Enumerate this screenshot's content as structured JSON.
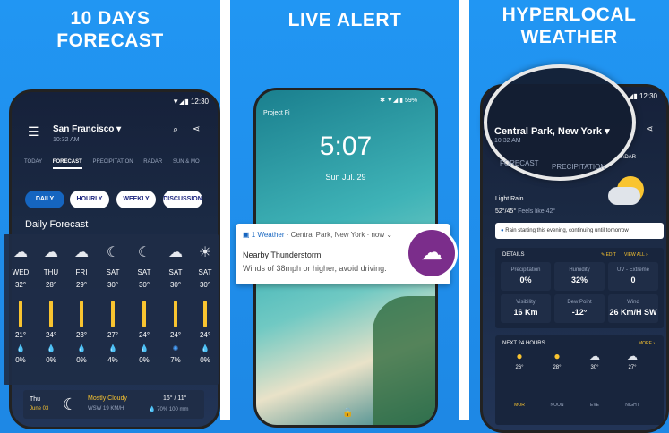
{
  "panel1": {
    "headline": [
      "10 DAYS",
      "FORECAST"
    ],
    "time": "12:30",
    "location": "San Francisco",
    "loc_time": "10:32 AM",
    "tabs": [
      "TODAY",
      "FORECAST",
      "PRECIPITATION",
      "RADAR",
      "SUN & MO"
    ],
    "chips": [
      "DAILY",
      "HOURLY",
      "WEEKLY",
      "DISCUSSION"
    ],
    "section_title": "Daily Forecast",
    "days": [
      {
        "day": "WED",
        "hi": "32°",
        "lo": "21°",
        "pct": "0%",
        "icon": "partly-cloudy-night-icon"
      },
      {
        "day": "THU",
        "hi": "28°",
        "lo": "24°",
        "pct": "0%",
        "icon": "partly-cloudy-night-icon"
      },
      {
        "day": "FRI",
        "hi": "29°",
        "lo": "23°",
        "pct": "0%",
        "icon": "partly-cloudy-night-icon"
      },
      {
        "day": "SAT",
        "hi": "30°",
        "lo": "27°",
        "pct": "4%",
        "icon": "moon-icon"
      },
      {
        "day": "SAT",
        "hi": "30°",
        "lo": "24°",
        "pct": "0%",
        "icon": "moon-icon"
      },
      {
        "day": "SAT",
        "hi": "30°",
        "lo": "24°",
        "pct": "7%",
        "icon": "partly-cloudy-night-icon"
      },
      {
        "day": "SAT",
        "hi": "30°",
        "lo": "24°",
        "pct": "0%",
        "icon": "partly-sunny-icon"
      }
    ],
    "bottom": {
      "day": "Thu",
      "date": "June 03",
      "cond": "Mostly Cloudy",
      "wind": "WSW 19 KM/H",
      "temps": "16° / 11°",
      "precip": "70% 100 mm"
    }
  },
  "panel2": {
    "headline": "LIVE ALERT",
    "carrier": "Project Fi",
    "battery": "59%",
    "clock": "5:07",
    "date": "Sun Jul. 29",
    "notif": {
      "app": "1 Weather",
      "location": "Central Park, New York",
      "when": "now",
      "title": "Nearby Thunderstorm",
      "body": "Winds of 38mph or higher, avoid driving."
    }
  },
  "panel3": {
    "headline": [
      "HYPERLOCAL",
      "WEATHER"
    ],
    "time": "12:30",
    "location": "Central Park, New York",
    "loc_time": "10:32 AM",
    "tabs": [
      "FORECAST",
      "PRECIPITATION",
      "RADAR"
    ],
    "current": "Light Rain",
    "temps": "52°/45°",
    "feels": "Feels like 42°",
    "alert": "Rain starting this evening, continuing until tomorrow",
    "details_title": "DETAILS",
    "edit": "EDIT",
    "view_all": "VIEW ALL",
    "details": [
      {
        "label": "Precipitation",
        "value": "0%"
      },
      {
        "label": "Humidity",
        "value": "32%"
      },
      {
        "label": "UV - Extreme",
        "value": "0"
      },
      {
        "label": "Visibility",
        "value": "16 Km"
      },
      {
        "label": "Dew Point",
        "value": "-12°"
      },
      {
        "label": "Wind",
        "value": "26 Km/H SW"
      }
    ],
    "next_title": "NEXT 24 HOURS",
    "more": "MORE",
    "hours": [
      {
        "temp": "26°",
        "label": "MOR"
      },
      {
        "temp": "28°",
        "label": "NOON"
      },
      {
        "temp": "30°",
        "label": "EVE"
      },
      {
        "temp": "27°",
        "label": "NIGHT"
      }
    ]
  },
  "colors": {
    "bg": "#2196f3",
    "accent": "#1565c0",
    "sun": "#f9c430",
    "alert": "#7b2d8b"
  }
}
